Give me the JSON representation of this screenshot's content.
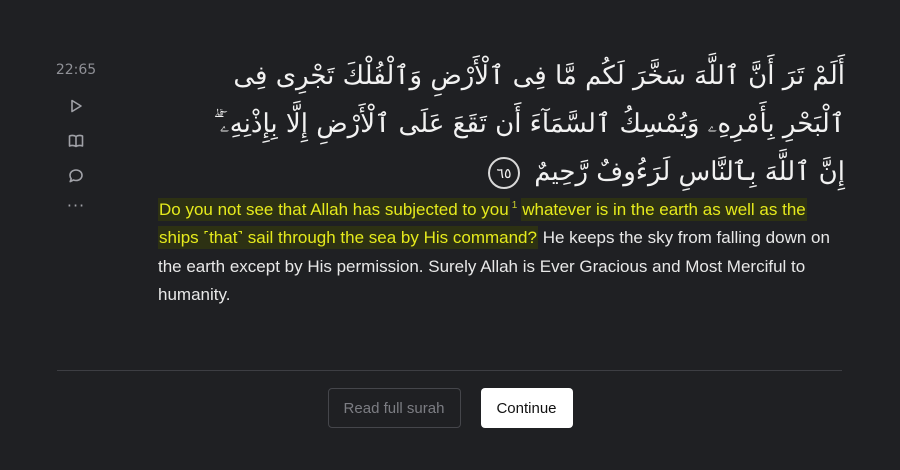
{
  "verse_key": "22:65",
  "sidebar": {
    "play_icon": "play-icon",
    "tafsir_icon": "book-icon",
    "reflection_icon": "chat-bubble-icon",
    "more_label": "···"
  },
  "verse": {
    "arabic_text": "أَلَمْ تَرَ أَنَّ ٱللَّهَ سَخَّرَ لَكُم مَّا فِى ٱلْأَرْضِ وَٱلْفُلْكَ تَجْرِى فِى ٱلْبَحْرِ بِأَمْرِهِۦ وَيُمْسِكُ ٱلسَّمَآءَ أَن تَقَعَ عَلَى ٱلْأَرْضِ إِلَّا بِإِذْنِهِۦٓ ۗ إِنَّ ٱللَّهَ بِٱلنَّاسِ لَرَءُوفٌ رَّحِيمٌ",
    "ayah_number": "٦٥",
    "translation": {
      "highlighted_part1": "Do you not see that Allah has subjected to you",
      "footnote_marker": "1",
      "highlighted_part2": "whatever is in the earth as well as the ships ˹that˺ sail through the sea by His command?",
      "rest": " He keeps the sky from falling down on the earth except by His permission. Surely Allah is Ever Gracious and Most Merciful to humanity."
    }
  },
  "actions": {
    "read_full_surah_label": "Read full surah",
    "continue_label": "Continue"
  },
  "colors": {
    "background": "#1f2023",
    "highlight_text": "#e5ea1c",
    "highlight_bg": "#2d3113"
  }
}
